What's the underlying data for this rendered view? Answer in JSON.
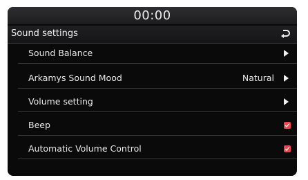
{
  "status_bar": {
    "time": "00:00"
  },
  "header": {
    "title": "Sound settings",
    "back_icon": "back-return-icon"
  },
  "menu": [
    {
      "label": "Sound Balance",
      "control": "arrow"
    },
    {
      "label": "Arkamys Sound Mood",
      "value": "Natural",
      "control": "arrow"
    },
    {
      "label": "Volume setting",
      "control": "arrow"
    },
    {
      "label": "Beep",
      "control": "checkbox",
      "checked": true
    },
    {
      "label": "Automatic Volume Control",
      "control": "checkbox",
      "checked": true
    }
  ],
  "colors": {
    "accent_checkbox": "#e8454f",
    "background": "#0a0a0a"
  }
}
